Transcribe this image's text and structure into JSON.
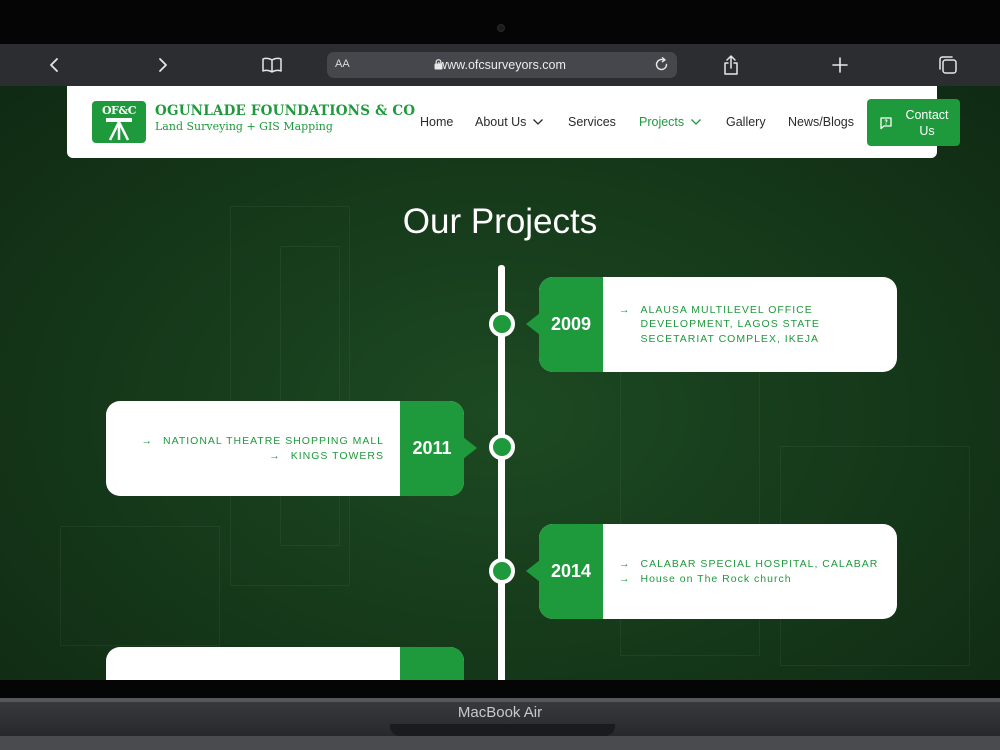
{
  "browser": {
    "text_size_label": "AA",
    "url": "www.ofcsurveyors.com"
  },
  "header": {
    "logo_text": "OF&C",
    "company_name": "OGUNLADE FOUNDATIONS & CO",
    "tagline": "Land Surveying + GIS Mapping",
    "nav": [
      {
        "label": "Home"
      },
      {
        "label": "About Us"
      },
      {
        "label": "Services"
      },
      {
        "label": "Projects"
      },
      {
        "label": "Gallery"
      },
      {
        "label": "News/Blogs"
      }
    ],
    "contact_label": "Contact Us"
  },
  "page": {
    "title": "Our Projects"
  },
  "timeline": [
    {
      "year": "2009",
      "projects": [
        "ALAUSA MULTILEVEL OFFICE DEVELOPMENT, LAGOS STATE SECETARIAT COMPLEX, IKEJA"
      ]
    },
    {
      "year": "2011",
      "projects": [
        "NATIONAL THEATRE SHOPPING MALL",
        "KINGS TOWERS"
      ]
    },
    {
      "year": "2014",
      "projects": [
        "CALABAR SPECIAL HOSPITAL, CALABAR",
        "House on The Rock church"
      ]
    }
  ],
  "device": {
    "brand": "MacBook Air"
  },
  "colors": {
    "brand_green": "#1e9a3c",
    "background_green": "#173d1c"
  },
  "icons": {
    "back": "chevron-left-icon",
    "forward": "chevron-right-icon",
    "reader": "book-icon",
    "lock": "lock-icon",
    "reload": "reload-icon",
    "share": "share-icon",
    "new_tab": "plus-icon",
    "tabs": "tabs-icon",
    "contact": "chat-icon",
    "project_bullet": "arrow-right-icon"
  }
}
